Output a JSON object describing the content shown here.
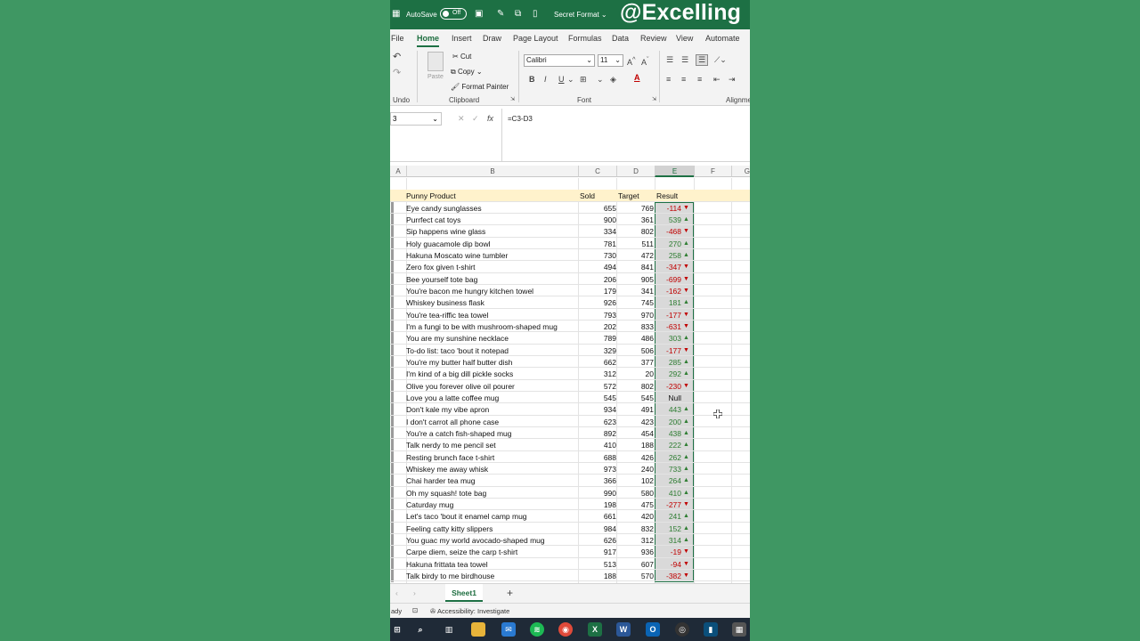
{
  "titlebar": {
    "autosave_label": "AutoSave",
    "autosave_state": "Off",
    "file_name": "Secret Format",
    "watermark": "@Excelling"
  },
  "tabs": [
    "File",
    "Home",
    "Insert",
    "Draw",
    "Page Layout",
    "Formulas",
    "Data",
    "Review",
    "View",
    "Automate"
  ],
  "active_tab": "Home",
  "ribbon": {
    "undo_label": "Undo",
    "clipboard": {
      "paste": "Paste",
      "cut": "Cut",
      "copy": "Copy",
      "format_painter": "Format Painter",
      "label": "Clipboard"
    },
    "font": {
      "name": "Calibri",
      "size": "11",
      "label": "Font"
    },
    "alignment_label": "Alignme"
  },
  "formula_bar": {
    "name_box": "3",
    "formula": "=C3-D3"
  },
  "columns": [
    "A",
    "B",
    "C",
    "D",
    "E",
    "F",
    "G"
  ],
  "selected_column": "E",
  "table": {
    "headers": {
      "product": "Punny Product",
      "sold": "Sold",
      "target": "Target",
      "result": "Result"
    },
    "rows": [
      {
        "product": "Eye candy sunglasses",
        "sold": "655",
        "target": "769",
        "result": "-114",
        "dir": "down"
      },
      {
        "product": "Purrfect cat toys",
        "sold": "900",
        "target": "361",
        "result": "539",
        "dir": "up"
      },
      {
        "product": "Sip happens wine glass",
        "sold": "334",
        "target": "802",
        "result": "-468",
        "dir": "down"
      },
      {
        "product": "Holy guacamole dip bowl",
        "sold": "781",
        "target": "511",
        "result": "270",
        "dir": "up"
      },
      {
        "product": "Hakuna Moscato wine tumbler",
        "sold": "730",
        "target": "472",
        "result": "258",
        "dir": "up"
      },
      {
        "product": "Zero fox given t-shirt",
        "sold": "494",
        "target": "841",
        "result": "-347",
        "dir": "down"
      },
      {
        "product": "Bee yourself tote bag",
        "sold": "206",
        "target": "905",
        "result": "-699",
        "dir": "down"
      },
      {
        "product": "You're bacon me hungry kitchen towel",
        "sold": "179",
        "target": "341",
        "result": "-162",
        "dir": "down"
      },
      {
        "product": "Whiskey business flask",
        "sold": "926",
        "target": "745",
        "result": "181",
        "dir": "up"
      },
      {
        "product": "You're tea-riffic tea towel",
        "sold": "793",
        "target": "970",
        "result": "-177",
        "dir": "down"
      },
      {
        "product": "I'm a fungi to be with mushroom-shaped mug",
        "sold": "202",
        "target": "833",
        "result": "-631",
        "dir": "down"
      },
      {
        "product": "You are my sunshine necklace",
        "sold": "789",
        "target": "486",
        "result": "303",
        "dir": "up"
      },
      {
        "product": "To-do list: taco 'bout it notepad",
        "sold": "329",
        "target": "506",
        "result": "-177",
        "dir": "down"
      },
      {
        "product": "You're my butter half butter dish",
        "sold": "662",
        "target": "377",
        "result": "285",
        "dir": "up"
      },
      {
        "product": "I'm kind of a big dill pickle socks",
        "sold": "312",
        "target": "20",
        "result": "292",
        "dir": "up"
      },
      {
        "product": "Olive you forever olive oil pourer",
        "sold": "572",
        "target": "802",
        "result": "-230",
        "dir": "down"
      },
      {
        "product": "Love you a latte coffee mug",
        "sold": "545",
        "target": "545",
        "result": "Null",
        "dir": "none"
      },
      {
        "product": "Don't kale my vibe apron",
        "sold": "934",
        "target": "491",
        "result": "443",
        "dir": "up"
      },
      {
        "product": "I don't carrot all phone case",
        "sold": "623",
        "target": "423",
        "result": "200",
        "dir": "up"
      },
      {
        "product": "You're a catch fish-shaped mug",
        "sold": "892",
        "target": "454",
        "result": "438",
        "dir": "up"
      },
      {
        "product": "Talk nerdy to me pencil set",
        "sold": "410",
        "target": "188",
        "result": "222",
        "dir": "up"
      },
      {
        "product": "Resting brunch face t-shirt",
        "sold": "688",
        "target": "426",
        "result": "262",
        "dir": "up"
      },
      {
        "product": "Whiskey me away whisk",
        "sold": "973",
        "target": "240",
        "result": "733",
        "dir": "up"
      },
      {
        "product": "Chai harder tea mug",
        "sold": "366",
        "target": "102",
        "result": "264",
        "dir": "up"
      },
      {
        "product": "Oh my squash! tote bag",
        "sold": "990",
        "target": "580",
        "result": "410",
        "dir": "up"
      },
      {
        "product": "Caturday mug",
        "sold": "198",
        "target": "475",
        "result": "-277",
        "dir": "down"
      },
      {
        "product": "Let's taco 'bout it enamel camp mug",
        "sold": "661",
        "target": "420",
        "result": "241",
        "dir": "up"
      },
      {
        "product": "Feeling catty kitty slippers",
        "sold": "984",
        "target": "832",
        "result": "152",
        "dir": "up"
      },
      {
        "product": "You guac my world avocado-shaped mug",
        "sold": "626",
        "target": "312",
        "result": "314",
        "dir": "up"
      },
      {
        "product": "Carpe diem, seize the carp t-shirt",
        "sold": "917",
        "target": "936",
        "result": "-19",
        "dir": "down"
      },
      {
        "product": "Hakuna frittata tea towel",
        "sold": "513",
        "target": "607",
        "result": "-94",
        "dir": "down"
      },
      {
        "product": "Talk birdy to me birdhouse",
        "sold": "188",
        "target": "570",
        "result": "-382",
        "dir": "down"
      }
    ]
  },
  "sheet_tab": "Sheet1",
  "add_sheet": "+",
  "status": {
    "ready": "ady",
    "accessibility": "Accessibility: Investigate"
  },
  "colors": {
    "excel_green": "#1d7044",
    "header_fill": "#fff2cc",
    "negative": "#c00000",
    "positive": "#2e7d32"
  }
}
